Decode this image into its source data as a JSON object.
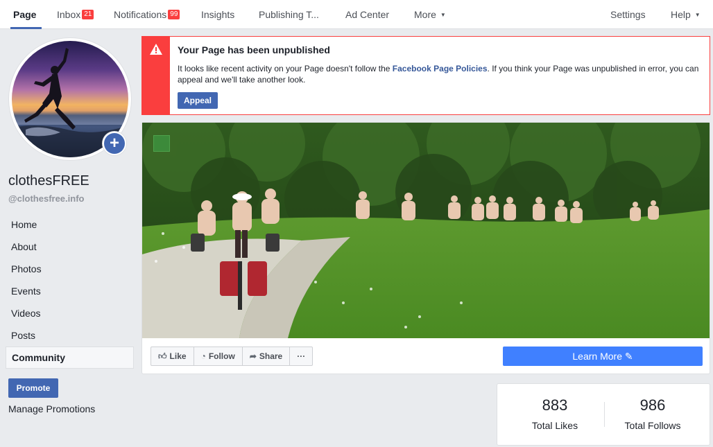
{
  "nav": {
    "items": [
      {
        "label": "Page"
      },
      {
        "label": "Inbox",
        "badge": "21"
      },
      {
        "label": "Notifications",
        "badge": "99"
      },
      {
        "label": "Insights"
      },
      {
        "label": "Publishing T..."
      },
      {
        "label": "Ad Center"
      },
      {
        "label": "More"
      }
    ],
    "settings": "Settings",
    "help": "Help"
  },
  "profile": {
    "name": "clothesFREE",
    "handle": "@clothesfree.info"
  },
  "sidebar": {
    "items": [
      {
        "label": "Home"
      },
      {
        "label": "About"
      },
      {
        "label": "Photos"
      },
      {
        "label": "Events"
      },
      {
        "label": "Videos"
      },
      {
        "label": "Posts"
      },
      {
        "label": "Community"
      }
    ],
    "promote": "Promote",
    "manage_promotions": "Manage Promotions"
  },
  "alert": {
    "title": "Your Page has been unpublished",
    "body_before": "It looks like recent activity on your Page doesn't follow the ",
    "link": "Facebook Page Policies",
    "body_after": ". If you think your Page was unpublished in error, you can appeal and we'll take another look.",
    "button": "Appeal"
  },
  "actions": {
    "like": "Like",
    "follow": "Follow",
    "share": "Share",
    "more": "···",
    "learn_more": "Learn More"
  },
  "stats": {
    "likes": "883",
    "likes_label": "Total Likes",
    "follows": "986",
    "follows_label": "Total Follows"
  },
  "colors": {
    "brand": "#4267b2",
    "alert": "#fa3e3e",
    "cta": "#4080ff"
  }
}
